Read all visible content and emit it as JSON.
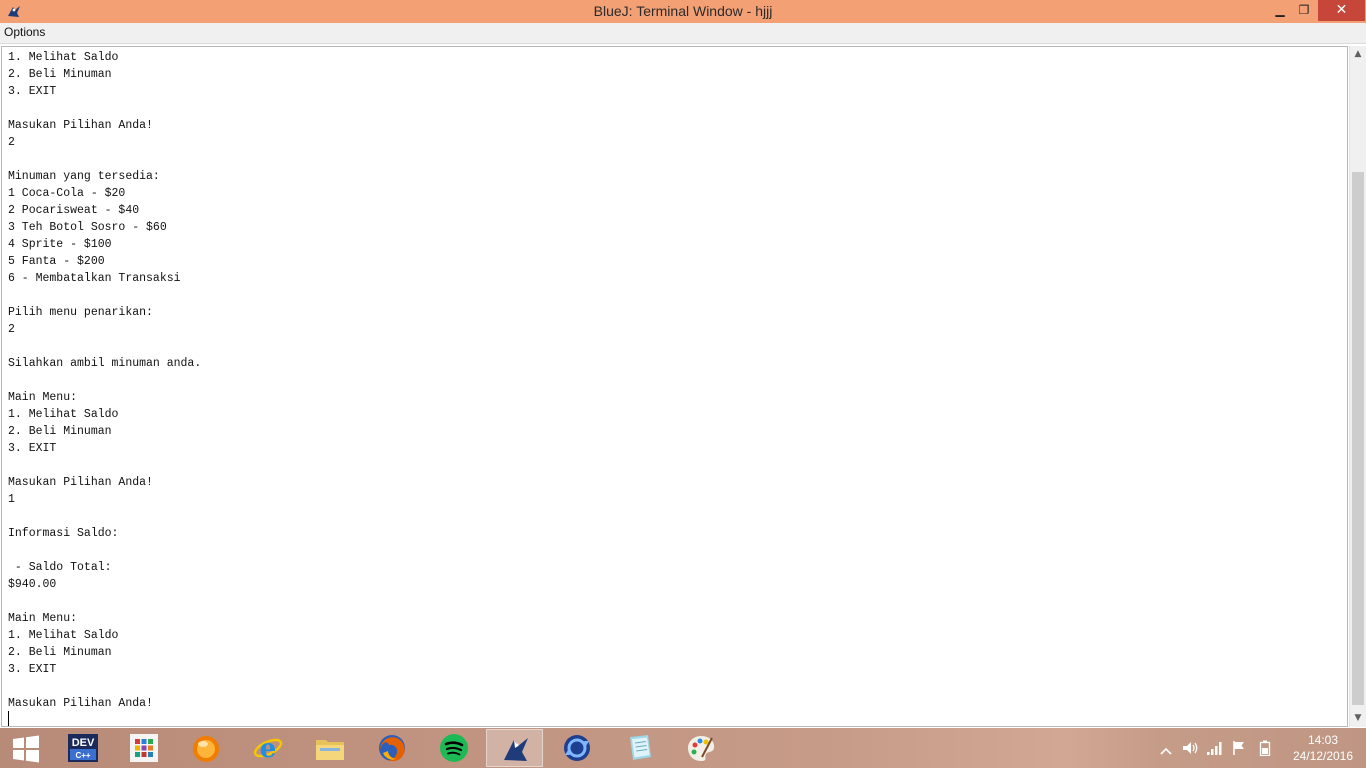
{
  "window": {
    "title": "BlueJ: Terminal Window - hjjj",
    "controls": {
      "minimize": "▁",
      "maximize": "❐",
      "close": "✕"
    }
  },
  "menubar": {
    "items": [
      {
        "label": "Options"
      }
    ]
  },
  "terminal": {
    "lines": [
      "1. Melihat Saldo",
      "2. Beli Minuman",
      "3. EXIT",
      "",
      "Masukan Pilihan Anda!",
      "2",
      "",
      "Minuman yang tersedia:",
      "1 Coca-Cola - $20",
      "2 Pocarisweat - $40",
      "3 Teh Botol Sosro - $60",
      "4 Sprite - $100",
      "5 Fanta - $200",
      "6 - Membatalkan Transaksi",
      "",
      "Pilih menu penarikan:",
      "2",
      "",
      "Silahkan ambil minuman anda.",
      "",
      "Main Menu:",
      "1. Melihat Saldo",
      "2. Beli Minuman",
      "3. EXIT",
      "",
      "Masukan Pilihan Anda!",
      "1",
      "",
      "Informasi Saldo:",
      "",
      " - Saldo Total:",
      "$940.00",
      "",
      "Main Menu:",
      "1. Melihat Saldo",
      "2. Beli Minuman",
      "3. EXIT",
      "",
      "Masukan Pilihan Anda!"
    ]
  },
  "scrollbar": {
    "position_fraction": 1.0
  },
  "taskbar": {
    "apps": [
      {
        "name": "windows-start",
        "icon": "windows-logo-icon",
        "active": false
      },
      {
        "name": "dev-cpp",
        "icon": "dev-cpp-icon",
        "label": "DEV",
        "active": false
      },
      {
        "name": "apps",
        "icon": "apps-grid-icon",
        "active": false
      },
      {
        "name": "orange-app",
        "icon": "orange-app-icon",
        "active": false
      },
      {
        "name": "internet-explorer",
        "icon": "internet-explorer-icon",
        "label": "e",
        "active": false
      },
      {
        "name": "file-explorer",
        "icon": "folder-icon",
        "active": false
      },
      {
        "name": "firefox",
        "icon": "firefox-icon",
        "active": false
      },
      {
        "name": "spotify",
        "icon": "spotify-icon",
        "active": false
      },
      {
        "name": "bluej",
        "icon": "bluej-icon",
        "active": true
      },
      {
        "name": "sync-app",
        "icon": "sync-icon",
        "active": false
      },
      {
        "name": "notepad",
        "icon": "notepad-icon",
        "active": false
      },
      {
        "name": "paint",
        "icon": "paint-palette-icon",
        "active": false
      }
    ],
    "tray": {
      "icons": [
        "chevron-up-icon",
        "speaker-icon",
        "network-icon",
        "flag-icon",
        "battery-icon"
      ],
      "time": "14:03",
      "date": "24/12/2016"
    }
  },
  "colors": {
    "titlebar": "#f2a074",
    "close_button": "#c7463a",
    "taskbar": "#c59c88",
    "spotify": "#1db954",
    "firefox": "#e66000"
  }
}
